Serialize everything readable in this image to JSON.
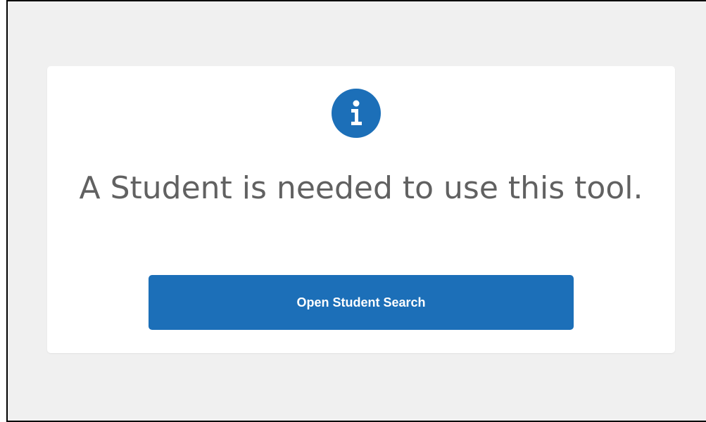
{
  "message": {
    "text": "A Student is needed to use this tool."
  },
  "info_icon": {
    "icon": "info-icon",
    "color": "#1c6fb8"
  },
  "action": {
    "label": "Open Student Search",
    "color": "#1c6fb8"
  }
}
